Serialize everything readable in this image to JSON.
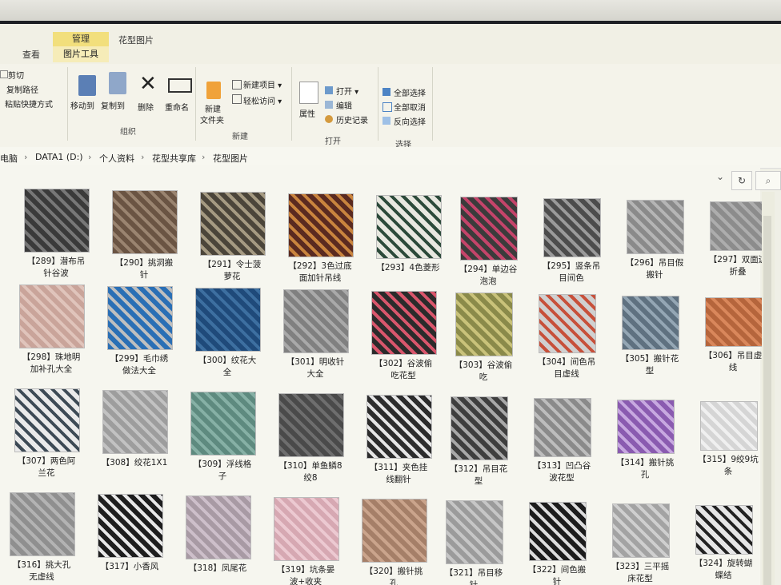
{
  "ribbon": {
    "tab_view": "查看",
    "tab_manage": "管理",
    "tab_picture_tools": "图片工具",
    "tab_title": "花型图片",
    "clipboard": {
      "cut": "剪切",
      "copy_path": "复制路径",
      "paste_shortcut": "粘贴快捷方式"
    },
    "organize": {
      "move_to": "移动到",
      "copy_to": "复制到",
      "delete": "删除",
      "rename": "重命名",
      "group": "组织"
    },
    "new": {
      "new_folder_line1": "新建",
      "new_folder_line2": "文件夹",
      "new_item": "新建项目 ▾",
      "easy_access": "轻松访问 ▾",
      "group": "新建"
    },
    "open": {
      "properties": "属性",
      "open": "打开 ▾",
      "edit": "编辑",
      "history": "历史记录",
      "group": "打开"
    },
    "select": {
      "select_all": "全部选择",
      "select_none": "全部取消",
      "invert": "反向选择",
      "group": "选择"
    }
  },
  "breadcrumb": [
    "电脑",
    "DATA1 (D:)",
    "个人资料",
    "花型共享库",
    "花型图片"
  ],
  "files": [
    {
      "l1": "【289】潜布吊",
      "l2": "针谷波",
      "color": "#3a3a3a",
      "accent": "#777"
    },
    {
      "l1": "【290】挑洞搬",
      "l2": "针",
      "color": "#6a5443",
      "accent": "#9a8470"
    },
    {
      "l1": "【291】令士菠",
      "l2": "萝花",
      "color": "#4b453a",
      "accent": "#a59a82"
    },
    {
      "l1": "【292】3色过底",
      "l2": "面加针吊线",
      "color": "#5a2a20",
      "accent": "#c9843e"
    },
    {
      "l1": "【293】4色菱形",
      "l2": "",
      "color": "#e8e8e0",
      "accent": "#2c4a3a"
    },
    {
      "l1": "【294】单边谷",
      "l2": "泡泡",
      "color": "#3b3b3b",
      "accent": "#c4446a"
    },
    {
      "l1": "【295】竖条吊",
      "l2": "目间色",
      "color": "#4c4c4c",
      "accent": "#9a9a9a"
    },
    {
      "l1": "【296】吊目假",
      "l2": "搬针",
      "color": "#8a8a8a",
      "accent": "#b5b5b5"
    },
    {
      "l1": "【297】双面边",
      "l2": "折叠",
      "color": "#8c8c8c",
      "accent": "#adadad"
    },
    {
      "l1": "【298】珠地明",
      "l2": "加补孔大全",
      "color": "#c9a49a",
      "accent": "#e0c4bb"
    },
    {
      "l1": "【299】毛巾绣",
      "l2": "做法大全",
      "color": "#2a6fb5",
      "accent": "#bfbfbf"
    },
    {
      "l1": "【300】纹花大",
      "l2": "全",
      "color": "#1f4a7a",
      "accent": "#3d6fa0"
    },
    {
      "l1": "【301】明收针",
      "l2": "大全",
      "color": "#808080",
      "accent": "#a9a9a9"
    },
    {
      "l1": "【302】谷波偷",
      "l2": "吃花型",
      "color": "#2b2b2b",
      "accent": "#d9566c"
    },
    {
      "l1": "【303】谷波偷",
      "l2": "吃",
      "color": "#8a8a4a",
      "accent": "#c9c27a"
    },
    {
      "l1": "【304】间色吊",
      "l2": "目虚线",
      "color": "#d0d0d0",
      "accent": "#c7503a"
    },
    {
      "l1": "【305】搬针花",
      "l2": "型",
      "color": "#5f7180",
      "accent": "#94a6b4"
    },
    {
      "l1": "【306】吊目虚",
      "l2": "线",
      "color": "#b5653c",
      "accent": "#d9875b"
    },
    {
      "l1": "【307】两色阿",
      "l2": "兰花",
      "color": "#eaeaea",
      "accent": "#3d4a55"
    },
    {
      "l1": "【308】绞花1X1",
      "l2": "",
      "color": "#9d9d9d",
      "accent": "#c2c2c2"
    },
    {
      "l1": "【309】浮线格",
      "l2": "子",
      "color": "#5e8a7f",
      "accent": "#86b0a5"
    },
    {
      "l1": "【310】单鱼鳞8",
      "l2": "绞8",
      "color": "#4a4a4a",
      "accent": "#6e6e6e"
    },
    {
      "l1": "【311】夹色挂",
      "l2": "线翻针",
      "color": "#2c2c2c",
      "accent": "#e5e5e5"
    },
    {
      "l1": "【312】吊目花",
      "l2": "型",
      "color": "#3e3e3e",
      "accent": "#a8a8a8"
    },
    {
      "l1": "【313】凹凸谷",
      "l2": "波花型",
      "color": "#8a8a8a",
      "accent": "#bdbdbd"
    },
    {
      "l1": "【314】搬针挑",
      "l2": "孔",
      "color": "#8a5bb0",
      "accent": "#c7a8e0"
    },
    {
      "l1": "【315】9绞9坑",
      "l2": "条",
      "color": "#d5d5d5",
      "accent": "#f0f0f0"
    },
    {
      "l1": "【316】挑大孔",
      "l2": "无虚线",
      "color": "#8f8f8f",
      "accent": "#b3b3b3"
    },
    {
      "l1": "【317】小香风",
      "l2": "",
      "color": "#1e1e1e",
      "accent": "#e8e8e8"
    },
    {
      "l1": "【318】凤尾花",
      "l2": "",
      "color": "#a89aa4",
      "accent": "#cdbfca"
    },
    {
      "l1": "【319】坑条晏",
      "l2": "波+收夹",
      "color": "#d6a8b2",
      "accent": "#ecc9d1"
    },
    {
      "l1": "【320】搬针挑",
      "l2": "孔",
      "color": "#a57f68",
      "accent": "#caa48c"
    },
    {
      "l1": "【321】吊目移",
      "l2": "针",
      "color": "#9b9b9b",
      "accent": "#c6c6c6"
    },
    {
      "l1": "【322】间色搬",
      "l2": "针",
      "color": "#1c1c1c",
      "accent": "#dcdcdc"
    },
    {
      "l1": "【323】三平摇",
      "l2": "床花型",
      "color": "#a3a3a3",
      "accent": "#cfcfcf"
    },
    {
      "l1": "【324】旋转蝴",
      "l2": "蝶结",
      "color": "#e6e6e6",
      "accent": "#222222"
    }
  ]
}
